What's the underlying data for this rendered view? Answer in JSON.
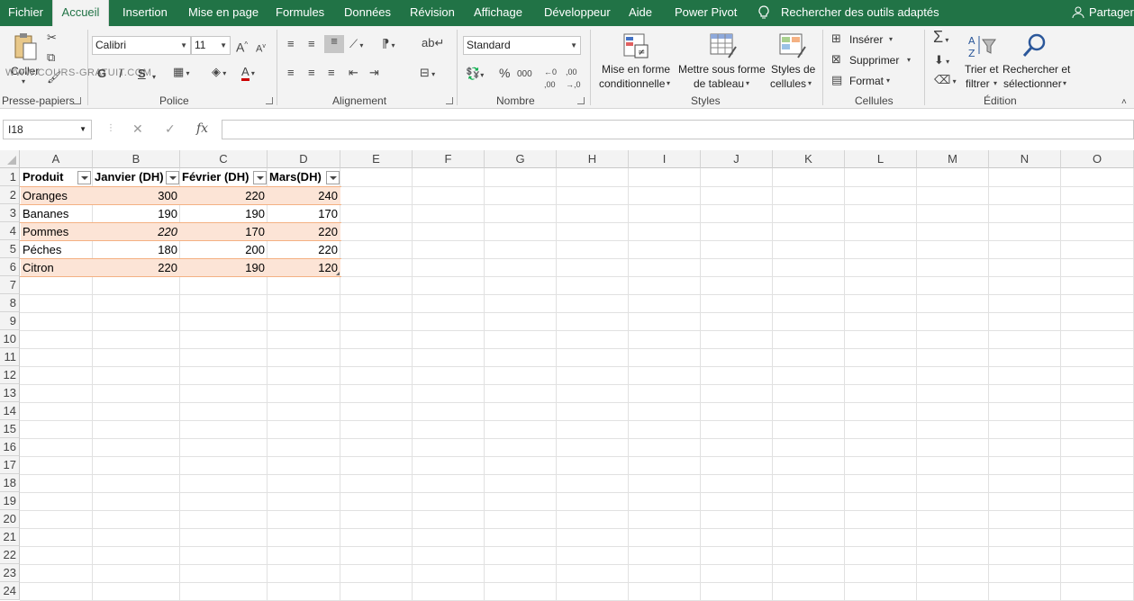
{
  "tabs": [
    "Fichier",
    "Accueil",
    "Insertion",
    "Mise en page",
    "Formules",
    "Données",
    "Révision",
    "Affichage",
    "Développeur",
    "Aide",
    "Power Pivot"
  ],
  "active_tab": "Accueil",
  "search_text": "Rechercher des outils adaptés",
  "share_label": "Partager",
  "ribbon": {
    "clipboard": {
      "paste_label": "Coller",
      "group_label": "Presse-papiers",
      "watermark": "WWW.COURS-GRATUIT.COM"
    },
    "font": {
      "font_name": "Calibri",
      "font_size": "11",
      "bold": "G",
      "italic": "I",
      "underline": "S",
      "group_label": "Police"
    },
    "alignment": {
      "group_label": "Alignement"
    },
    "number": {
      "format": "Standard",
      "percent": "%",
      "thousands": "000",
      "group_label": "Nombre"
    },
    "styles": {
      "conditional": [
        "Mise en forme",
        "conditionnelle"
      ],
      "table": [
        "Mettre sous forme",
        "de tableau"
      ],
      "cell_styles": [
        "Styles de",
        "cellules"
      ],
      "group_label": "Styles"
    },
    "cells": {
      "insert": "Insérer",
      "delete": "Supprimer",
      "format": "Format",
      "group_label": "Cellules"
    },
    "editing": {
      "sort": [
        "Trier et",
        "filtrer"
      ],
      "find": [
        "Rechercher et",
        "sélectionner"
      ],
      "group_label": "Édition"
    }
  },
  "formula_bar": {
    "name_box": "I18",
    "fx": "fx",
    "cancel": "✕",
    "enter": "✓",
    "value": ""
  },
  "columns": [
    "A",
    "B",
    "C",
    "D",
    "E",
    "F",
    "G",
    "H",
    "I",
    "J",
    "K",
    "L",
    "M",
    "N",
    "O"
  ],
  "rows": [
    "1",
    "2",
    "3",
    "4",
    "5",
    "6",
    "7",
    "8",
    "9",
    "10",
    "11",
    "12",
    "13",
    "14",
    "15",
    "16",
    "17",
    "18",
    "19",
    "20",
    "21",
    "22",
    "23",
    "24"
  ],
  "table": {
    "headers": [
      "Produit",
      "Janvier (DH)",
      "Février (DH)",
      "Mars(DH)"
    ],
    "rows": [
      [
        "Oranges",
        "300",
        "220",
        "240"
      ],
      [
        "Bananes",
        "190",
        "190",
        "170"
      ],
      [
        "Pommes",
        "220",
        "170",
        "220"
      ],
      [
        "Péches",
        "180",
        "200",
        "220"
      ],
      [
        "Citron",
        "220",
        "190",
        "120"
      ]
    ],
    "band_color": "#fce4d6",
    "border_color": "#f4b183"
  },
  "accent_color": "#217346"
}
